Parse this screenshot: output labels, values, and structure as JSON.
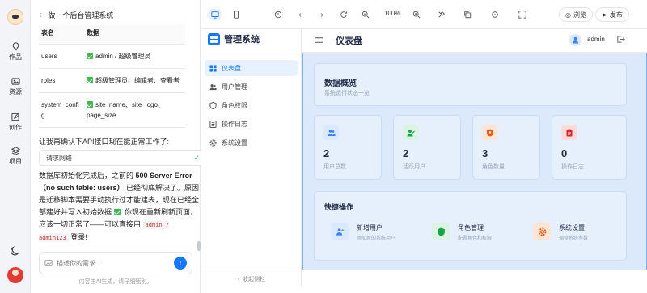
{
  "rail": {
    "items": [
      {
        "label": "作品",
        "icon": "lightbulb-icon"
      },
      {
        "label": "资源",
        "icon": "image-icon"
      },
      {
        "label": "创作",
        "icon": "edit-icon"
      },
      {
        "label": "项目",
        "icon": "layers-icon"
      }
    ]
  },
  "chat": {
    "title": "做一个后台管理系统",
    "table": {
      "headers": [
        "表名",
        "数据"
      ],
      "rows": [
        {
          "name": "users",
          "data": "admin / 超级管理员"
        },
        {
          "name": "roles",
          "data": "超级管理员、编辑者、查看者"
        },
        {
          "name": "system_config",
          "data": "site_name、site_logo、page_size"
        }
      ]
    },
    "ask": "让我再确认下API接口现在能正常工作了:",
    "request_label": "请求网络",
    "answer": {
      "p1": "数据库初始化完成后，之前的",
      "error": "500 Server Error（no such table: users）",
      "p2": "已经彻底解决了。原因是迁移脚本需要手动执行过才能建表，现在已经全部建好并写入初始数据",
      "p3": "你现在重新刷新页面，应该一切正常了——可以直接用",
      "cred": "admin / admin123",
      "p4": "登录!"
    },
    "input_placeholder": "描述你的需求...",
    "disclaimer": "内容由AI生成，请仔细甄别。"
  },
  "toolbar": {
    "zoom": "100%",
    "browse": "浏览",
    "publish": "发布"
  },
  "app": {
    "brand": "管理系统",
    "nav": [
      {
        "label": "仪表盘",
        "icon": "dashboard-icon",
        "active": true
      },
      {
        "label": "用户管理",
        "icon": "users-icon",
        "active": false
      },
      {
        "label": "角色权限",
        "icon": "shield-icon",
        "active": false
      },
      {
        "label": "操作日志",
        "icon": "log-icon",
        "active": false
      },
      {
        "label": "系统设置",
        "icon": "gear-icon",
        "active": false
      }
    ],
    "collapse": "收起侧栏",
    "header_title": "仪表盘",
    "user": "admin",
    "overview_title": "数据概览",
    "overview_sub": "系统运行状态一览",
    "stats": [
      {
        "value": "2",
        "label": "用户总数",
        "color": "#3b82f6",
        "bg": "#dbe9ff"
      },
      {
        "value": "2",
        "label": "活跃用户",
        "color": "#16a34a",
        "bg": "#dcf3e4"
      },
      {
        "value": "3",
        "label": "角色数量",
        "color": "#ea580c",
        "bg": "#fde4d4"
      },
      {
        "value": "0",
        "label": "操作日志",
        "color": "#dc2626",
        "bg": "#fbdada"
      }
    ],
    "quick_title": "快捷操作",
    "quick": [
      {
        "title": "新增用户",
        "desc": "添加新的系统用户",
        "color": "#3b82f6",
        "bg": "#dbe9ff"
      },
      {
        "title": "角色管理",
        "desc": "配置角色和权限",
        "color": "#16a34a",
        "bg": "#dcf3e4"
      },
      {
        "title": "系统设置",
        "desc": "调整系统参数",
        "color": "#ea580c",
        "bg": "#fde4d4"
      }
    ]
  }
}
